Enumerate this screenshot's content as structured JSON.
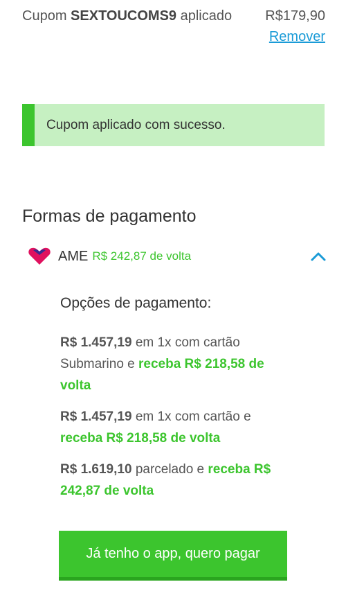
{
  "coupon": {
    "prefix": "Cupom",
    "code": "SEXTOUCOMS9",
    "suffix": "aplicado",
    "value": "R$179,90",
    "remove_label": "Remover"
  },
  "alert": {
    "message": "Cupom aplicado com sucesso."
  },
  "payment": {
    "title": "Formas de pagamento",
    "method": {
      "name": "AME",
      "cashback": "R$ 242,87 de volta",
      "logo_icon": "ame-heart-logo",
      "expand_icon": "chevron-up-icon"
    },
    "options_title": "Opções de pagamento:",
    "options": [
      {
        "price": "R$ 1.457,19",
        "text": "em 1x com cartão Submarino e",
        "cashback": "receba R$ 218,58 de volta"
      },
      {
        "price": "R$ 1.457,19",
        "text": "em 1x com cartão e",
        "cashback": "receba R$ 218,58 de volta"
      },
      {
        "price": "R$ 1.619,10",
        "text": "parcelado e",
        "cashback": "receba R$ 242,87 de volta"
      }
    ],
    "button_label": "Já tenho o app, quero pagar"
  },
  "colors": {
    "accent_green": "#3cc52e",
    "alert_bg": "#c6f0c2",
    "link_blue": "#1a9bd7",
    "ame_pink": "#e0115f"
  }
}
